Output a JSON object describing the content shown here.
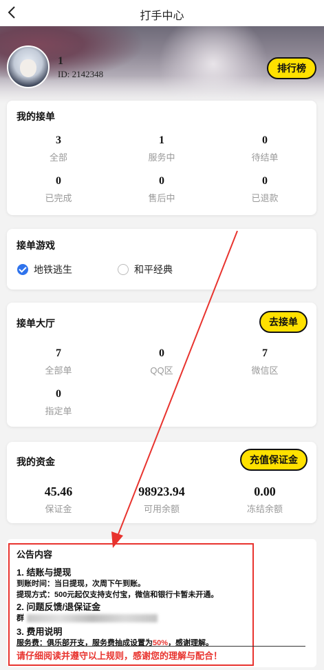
{
  "header": {
    "title": "打手中心",
    "back_icon": "chevron-left-icon"
  },
  "profile": {
    "name": "1",
    "id_text": "ID: 2142348",
    "rank_button": "排行榜"
  },
  "my_orders": {
    "title": "我的接单",
    "stats": [
      {
        "value": "3",
        "label": "全部"
      },
      {
        "value": "1",
        "label": "服务中"
      },
      {
        "value": "0",
        "label": "待结单"
      },
      {
        "value": "0",
        "label": "已完成"
      },
      {
        "value": "0",
        "label": "售后中"
      },
      {
        "value": "0",
        "label": "已退款"
      }
    ]
  },
  "games": {
    "title": "接单游戏",
    "options": [
      {
        "label": "地铁逃生",
        "checked": true
      },
      {
        "label": "和平经典",
        "checked": false
      }
    ]
  },
  "hall": {
    "title": "接单大厅",
    "button": "去接单",
    "stats": [
      {
        "value": "7",
        "label": "全部单"
      },
      {
        "value": "0",
        "label": "QQ区"
      },
      {
        "value": "7",
        "label": "微信区"
      },
      {
        "value": "0",
        "label": "指定单"
      }
    ]
  },
  "funds": {
    "title": "我的资金",
    "button": "充值保证金",
    "stats": [
      {
        "value": "45.46",
        "label": "保证金"
      },
      {
        "value": "98923.94",
        "label": "可用余额"
      },
      {
        "value": "0.00",
        "label": "冻结余额"
      }
    ]
  },
  "notice": {
    "title": "公告内容",
    "sec1": "1. 结账与提现",
    "sec1_l1": "到账时间：当日提现，次周下午到账。",
    "sec1_l2": "提现方式：500元起仅支持支付宝，微信和银行卡暂未开通。",
    "sec2": "2. 问题反馈/退保证金",
    "sec2_l1_prefix": "群",
    "sec3": "3. 费用说明",
    "fee_a": "服务费：俱乐部开支，服务费抽成设置为",
    "fee_pct": "50%",
    "fee_b": "，感谢理解。",
    "warning": "请仔细阅读并遵守以上规则，感谢您的理解与配合！"
  },
  "colors": {
    "accent_yellow": "#ffe100",
    "check_blue": "#2f73ec",
    "annotation_red": "#e8332e"
  }
}
